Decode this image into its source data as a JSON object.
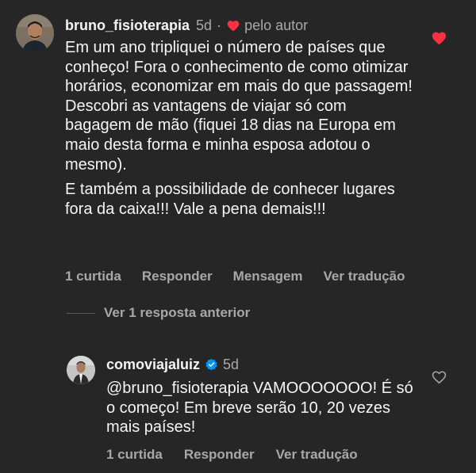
{
  "comment": {
    "username": "bruno_fisioterapia",
    "time": "5d",
    "separator": "·",
    "author_like_label": "pelo autor",
    "paragraphs": [
      "Em um ano tripliquei o número de países que conheço! Fora o conhecimento de como otimizar horários, economizar em mais do que passagem! Descobri as vantagens de viajar só com bagagem de mão (fiquei 18 dias na Europa em maio desta forma e minha esposa adotou o mesmo).",
      "E também a possibilidade de conhecer lugares fora da caixa!!! Vale a pena demais!!!"
    ],
    "actions": {
      "likes": "1 curtida",
      "reply": "Responder",
      "message": "Mensagem",
      "translate": "Ver tradução"
    },
    "liked": true,
    "like_icon": "heart-filled-icon",
    "like_color": "#ff3040"
  },
  "replies_toggle": {
    "label": "Ver 1 resposta anterior"
  },
  "reply": {
    "username": "comoviajaluiz",
    "verified": true,
    "verified_icon": "verified-badge-icon",
    "verified_color": "#0095f6",
    "time": "5d",
    "text": "@bruno_fisioterapia VAMOOOOOOO! É só o começo! Em breve serão 10, 20 vezes mais países!",
    "actions": {
      "likes": "1 curtida",
      "reply": "Responder",
      "translate": "Ver tradução"
    },
    "liked": false,
    "like_icon": "heart-outline-icon"
  }
}
